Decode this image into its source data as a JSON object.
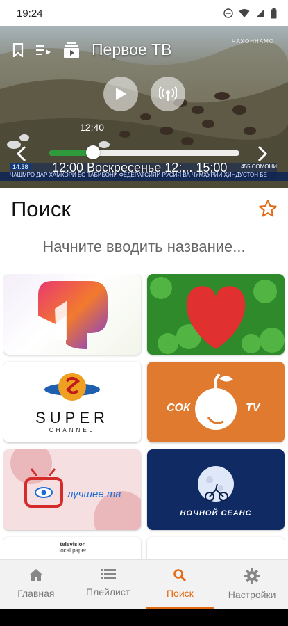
{
  "status": {
    "time": "19:24"
  },
  "player": {
    "channel_title": "Первое ТВ",
    "watermark": "ЧАҲОННАМО",
    "elapsed": "12:40",
    "progress_fraction": 0.23,
    "program": "12:00 Воскресенье 12:... 15:00",
    "ticker_badge": "14:38",
    "ticker_right": "455 СОМОНИ",
    "ticker_text": "ЧАШМРО ДАР ХАМКОРИ БО ТАБИБОНИ ФЕДЕРАТСИЯИ РУСИЯ ВА ЧУМҲУРИИ ҲИНДУСТОН БЕ"
  },
  "search": {
    "title": "Поиск",
    "placeholder": "Начните вводить название..."
  },
  "channels": [
    {
      "label": ""
    },
    {
      "label": ""
    },
    {
      "label": "SUPER",
      "sub": "CHANNEL"
    },
    {
      "label": "СОК",
      "sub": "TV"
    },
    {
      "label": "лучшее.тв"
    },
    {
      "label": "НОЧНОЙ СЕАНС"
    },
    {
      "label": ""
    },
    {
      "label": ""
    }
  ],
  "channel7_words": [
    "television",
    "local paper"
  ],
  "nav": {
    "items": [
      {
        "label": "Главная",
        "icon": "home-icon"
      },
      {
        "label": "Плейлист",
        "icon": "playlist-icon"
      },
      {
        "label": "Поиск",
        "icon": "search-icon"
      },
      {
        "label": "Настройки",
        "icon": "gear-icon"
      }
    ],
    "active_index": 2
  },
  "colors": {
    "accent": "#e36a12",
    "progress": "#2e9a3b"
  }
}
